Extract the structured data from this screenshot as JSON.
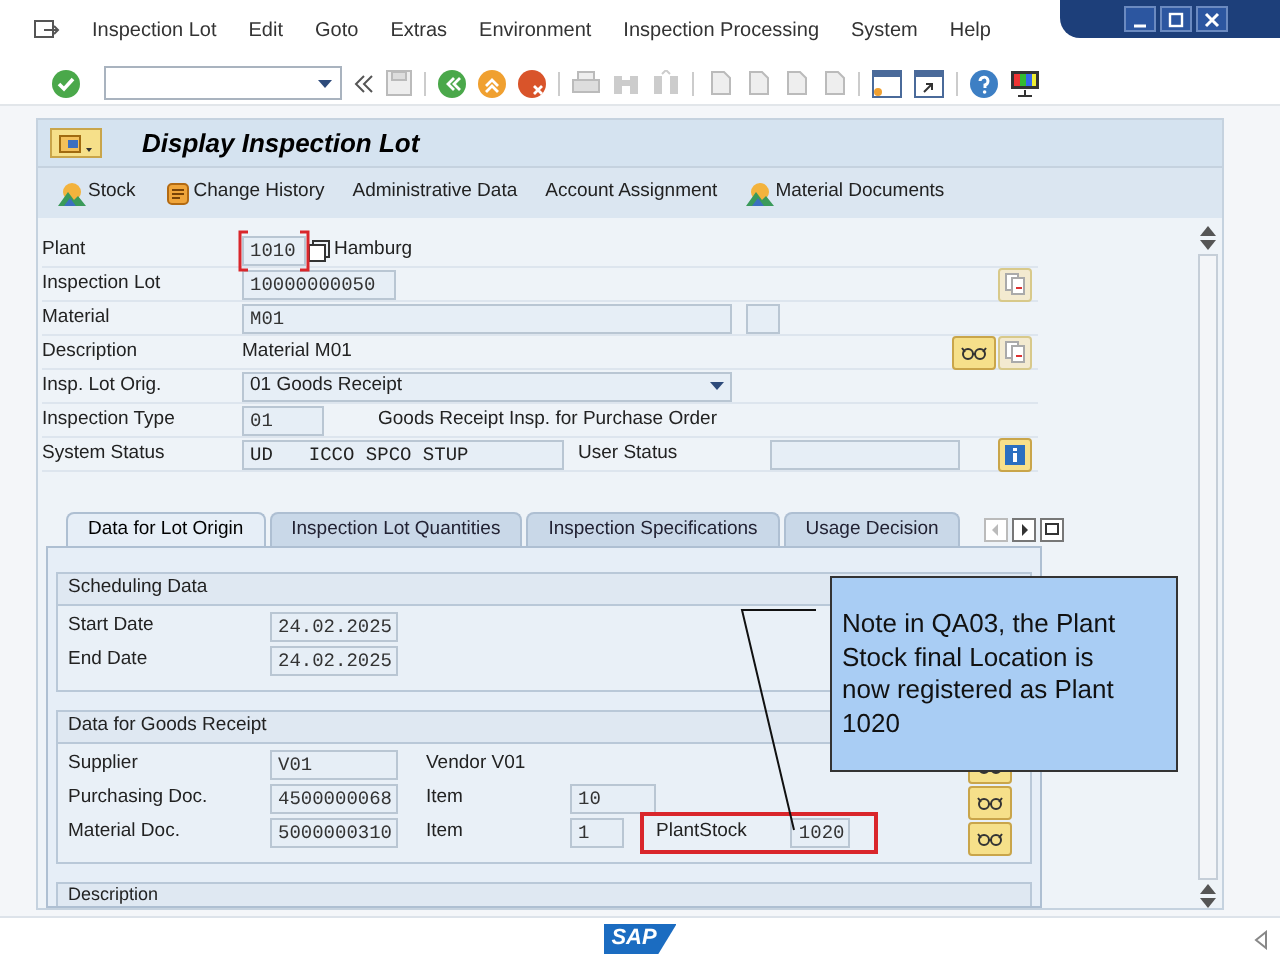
{
  "menu": [
    {
      "label": "Inspection Lot"
    },
    {
      "label": "Edit"
    },
    {
      "label": "Goto"
    },
    {
      "label": "Extras"
    },
    {
      "label": "Environment"
    },
    {
      "label": "Inspection Processing"
    },
    {
      "label": "System"
    },
    {
      "label": "Help"
    }
  ],
  "title": "Display Inspection Lot",
  "app_toolbar": [
    {
      "label": "Stock"
    },
    {
      "label": "Change History"
    },
    {
      "label": "Administrative Data"
    },
    {
      "label": "Account Assignment"
    },
    {
      "label": "Material Documents"
    }
  ],
  "header": [
    {
      "kind": "plant",
      "label": "Plant",
      "value": "1010",
      "description": "Hamburg",
      "highlighted": true
    },
    {
      "kind": "input",
      "label": "Inspection Lot",
      "value": "10000000050"
    },
    {
      "kind": "wide",
      "label": "Material",
      "value": "M01"
    },
    {
      "kind": "text",
      "label": "Description",
      "value": "Material M01"
    },
    {
      "kind": "dropdown",
      "label": "Insp. Lot Orig.",
      "value": "01 Goods Receipt"
    },
    {
      "kind": "short",
      "label": "Inspection Type",
      "value": "01",
      "description": "Goods Receipt Insp. for Purchase Order"
    },
    {
      "kind": "status",
      "label": "System Status",
      "value": "UD",
      "value_2": "ICCO SPCO STUP",
      "second_label": "User Status"
    }
  ],
  "tabs": [
    {
      "label": "Data for Lot Origin",
      "selected": true
    },
    {
      "label": "Inspection Lot Quantities",
      "selected": false
    },
    {
      "label": "Inspection Specifications",
      "selected": false
    },
    {
      "label": "Usage Decision",
      "selected": false
    }
  ],
  "scheduling": {
    "title": "Scheduling Data",
    "rows": [
      {
        "label": "Start Date",
        "value": "24.02.2025"
      },
      {
        "label": "End Date",
        "value": "24.02.2025"
      }
    ]
  },
  "goods_receipt": {
    "title": "Data for Goods Receipt",
    "rows": [
      {
        "label": "Supplier",
        "value": "V01",
        "description": "Vendor V01"
      },
      {
        "label": "Purchasing Doc.",
        "value": "4500000068",
        "item_label": "Item",
        "item_value": "10"
      },
      {
        "label": "Material Doc.",
        "value": "5000000310",
        "item_label": "Item",
        "item_value": "1",
        "plant_stock_label": "PlantStock",
        "plant_stock_value": "1020",
        "highlighted": true
      }
    ]
  },
  "description_section": {
    "title": "Description"
  },
  "logo": "SAP",
  "callout": {
    "text": "Note in QA03, the Plant Stock final Location is now registered as Plant 1020"
  }
}
